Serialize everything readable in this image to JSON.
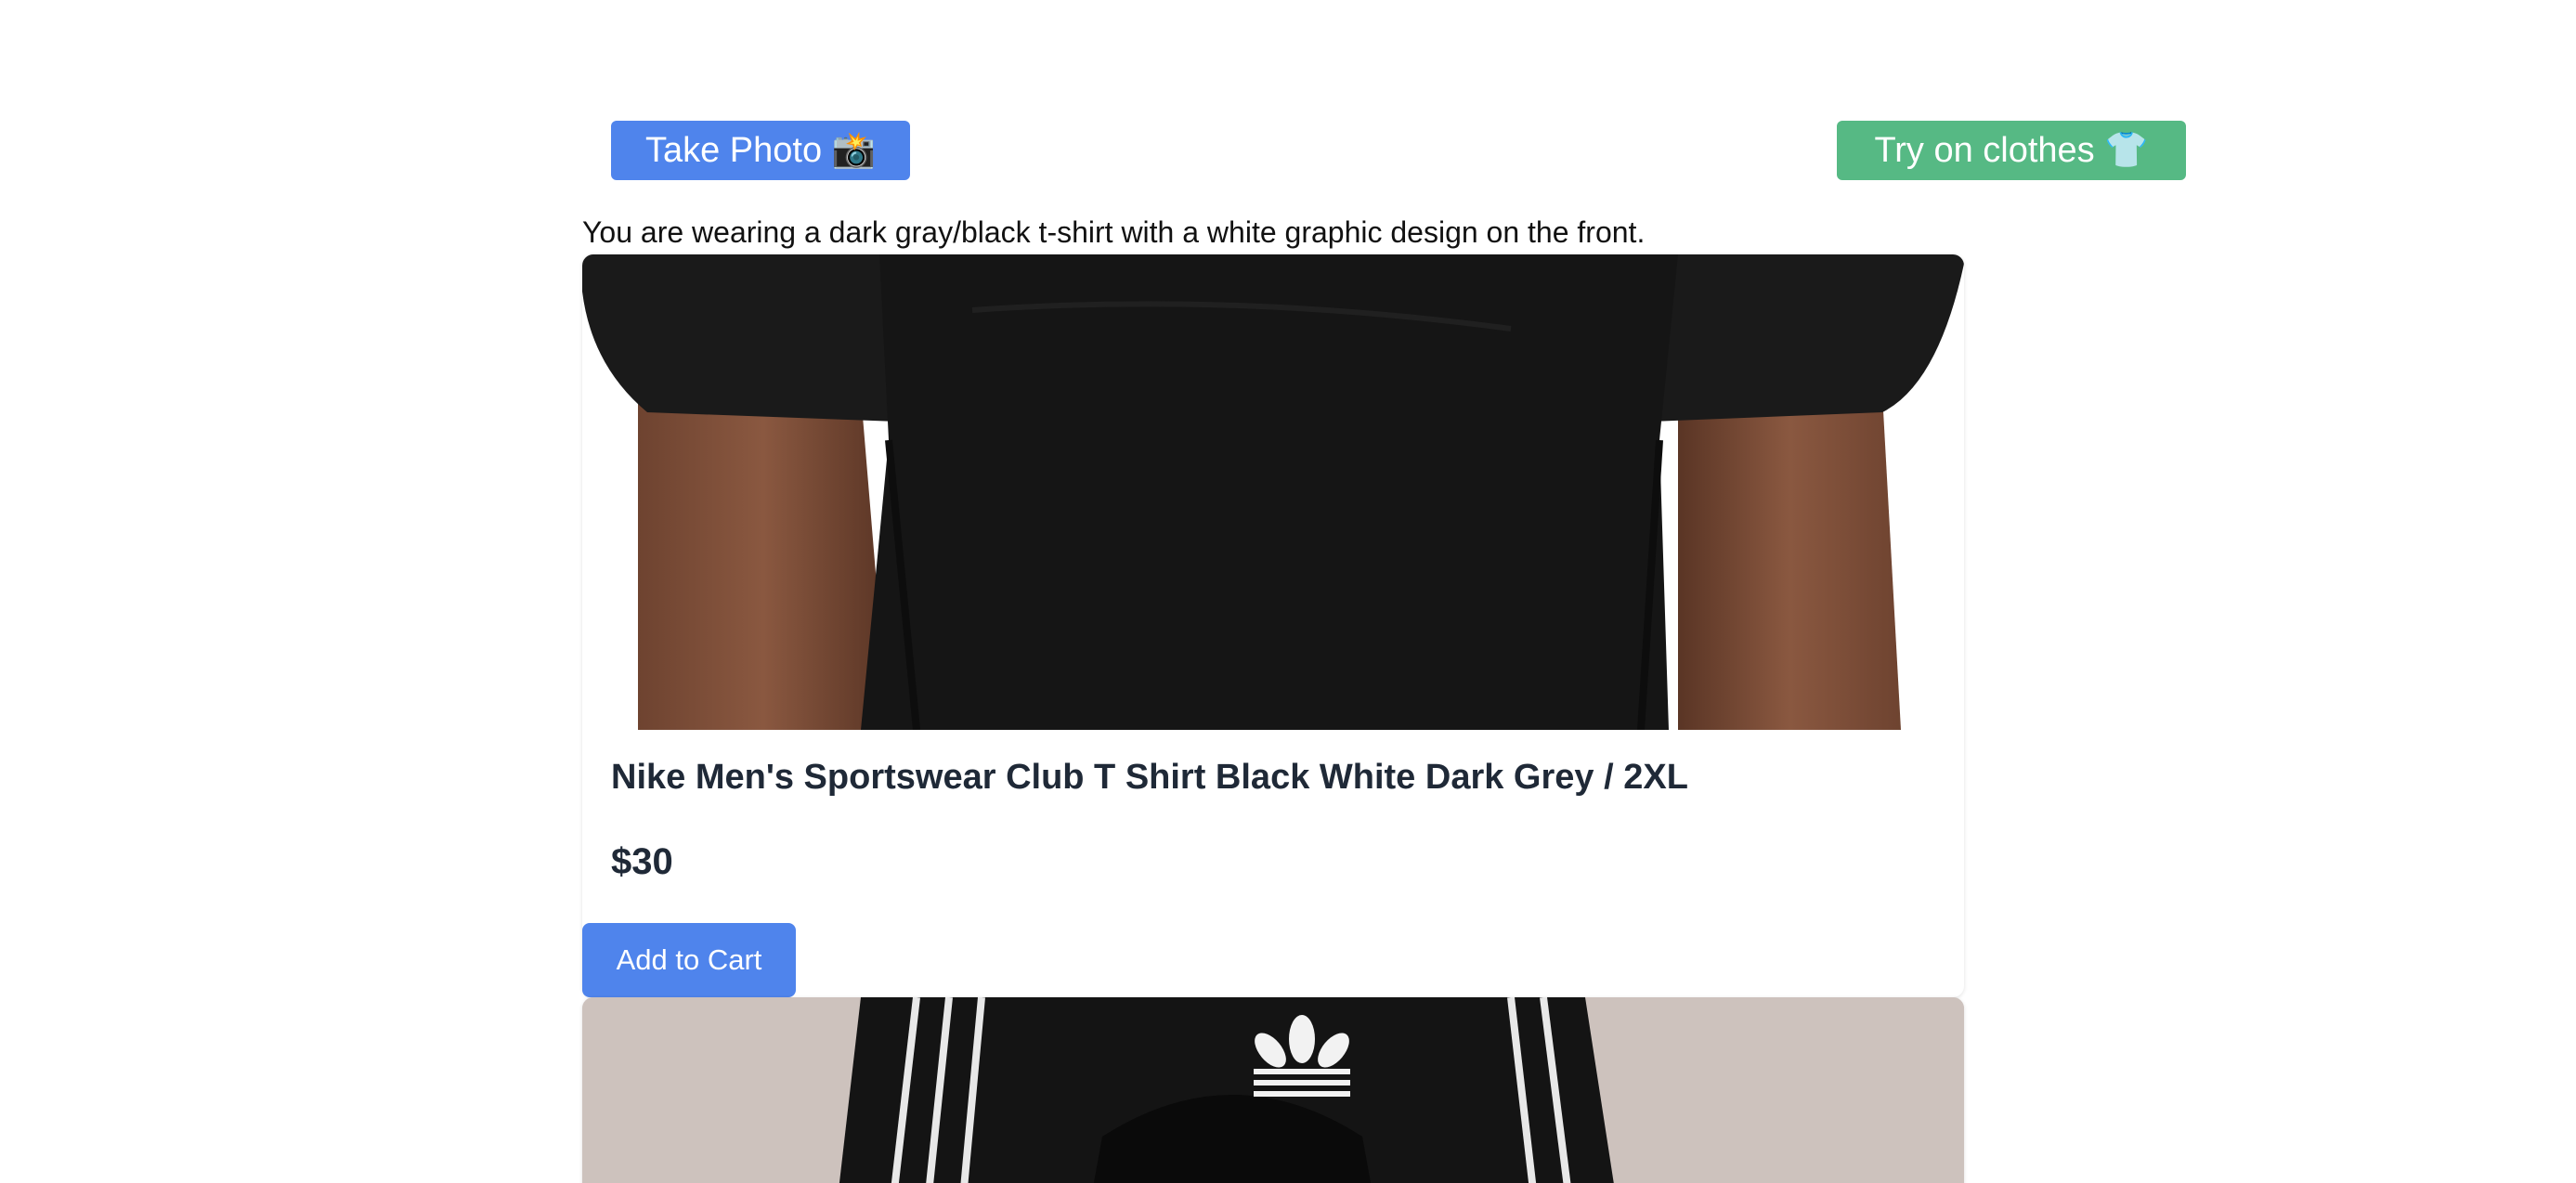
{
  "toolbar": {
    "take_photo_label": "Take Photo 📸",
    "try_on_label": "Try on clothes 👕"
  },
  "description": "You are wearing a dark gray/black t-shirt with a white graphic design on the front.",
  "products": [
    {
      "title": "Nike Men's Sportswear Club T Shirt Black White Dark Grey / 2XL",
      "price": "$30",
      "add_to_cart_label": "Add to Cart",
      "image_icon": "black-tshirt-photo"
    },
    {
      "image_icon": "adidas-black-top-photo"
    }
  ],
  "colors": {
    "primary_button": "#4f84ec",
    "try_on_button": "#56b984",
    "text": "#1f2937"
  }
}
